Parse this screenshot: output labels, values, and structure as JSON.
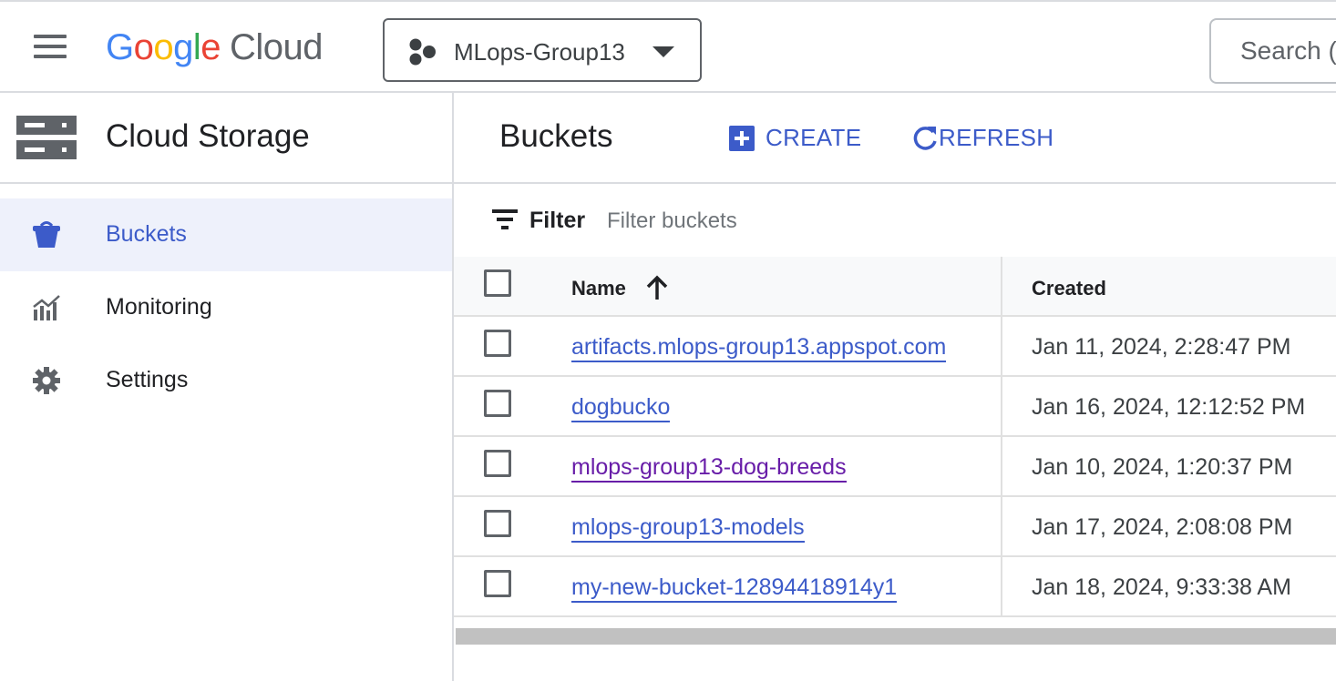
{
  "header": {
    "logo_text": {
      "g1": "G",
      "g2": "o",
      "g3": "o",
      "g4": "g",
      "g5": "l",
      "g6": "e",
      "cloud": "Cloud"
    },
    "project_name": "MLops-Group13",
    "search_placeholder": "Search (",
    "icons": {
      "menu": "hamburger-menu-icon",
      "project": "project-hexagon-icon",
      "caret": "caret-down-icon"
    }
  },
  "sidebar": {
    "product_title": "Cloud Storage",
    "product_icon": "storage-server-icon",
    "items": [
      {
        "label": "Buckets",
        "icon": "bucket-icon",
        "active": true
      },
      {
        "label": "Monitoring",
        "icon": "monitoring-chart-icon",
        "active": false
      },
      {
        "label": "Settings",
        "icon": "gear-icon",
        "active": false
      }
    ]
  },
  "main": {
    "title": "Buckets",
    "create_label": "CREATE",
    "refresh_label": "REFRESH",
    "filter_label": "Filter",
    "filter_placeholder": "Filter buckets",
    "table": {
      "columns": {
        "name": "Name",
        "created": "Created"
      },
      "sort": "ascending",
      "rows": [
        {
          "name": "artifacts.mlops-group13.appspot.com",
          "created": "Jan 11, 2024, 2:28:47 PM",
          "visited": false
        },
        {
          "name": "dogbucko",
          "created": "Jan 16, 2024, 12:12:52 PM",
          "visited": false
        },
        {
          "name": "mlops-group13-dog-breeds",
          "created": "Jan 10, 2024, 1:20:37 PM",
          "visited": true
        },
        {
          "name": "mlops-group13-models",
          "created": "Jan 17, 2024, 2:08:08 PM",
          "visited": false
        },
        {
          "name": "my-new-bucket-12894418914y1",
          "created": "Jan 18, 2024, 9:33:38 AM",
          "visited": false
        }
      ]
    }
  },
  "colors": {
    "accent": "#3c5bc9",
    "visited_link": "#681da8",
    "active_nav_bg": "#eef1fb",
    "divider": "#dadce0"
  }
}
